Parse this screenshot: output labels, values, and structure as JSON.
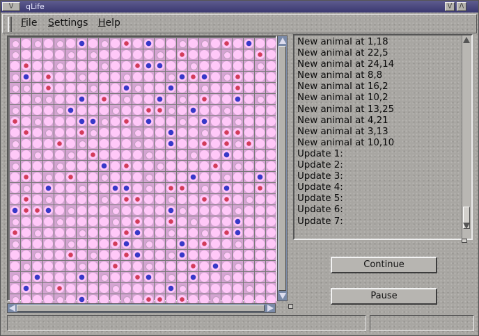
{
  "window": {
    "title": "qLife",
    "menu_button_label": "\\/",
    "minimize_label": "\\/",
    "maximize_label": "/\\"
  },
  "menubar": {
    "items": [
      {
        "label": "File",
        "mnemonic": "F",
        "rest": "ile"
      },
      {
        "label": "Settings",
        "mnemonic": "S",
        "rest": "ettings"
      },
      {
        "label": "Help",
        "mnemonic": "H",
        "rest": "elp"
      }
    ]
  },
  "grid": {
    "rows": 24,
    "cols": 24,
    "colors": {
      "cell_bg": "#d4a4d2",
      "dot": "#ffc8f8",
      "red": "#d23c5a",
      "blue": "#3838c8"
    },
    "red_cells": [
      [
        0,
        10
      ],
      [
        0,
        19
      ],
      [
        1,
        15
      ],
      [
        1,
        22
      ],
      [
        2,
        1
      ],
      [
        2,
        11
      ],
      [
        3,
        3
      ],
      [
        3,
        16
      ],
      [
        3,
        20
      ],
      [
        4,
        3
      ],
      [
        4,
        20
      ],
      [
        5,
        8
      ],
      [
        5,
        17
      ],
      [
        6,
        12
      ],
      [
        6,
        13
      ],
      [
        7,
        0
      ],
      [
        7,
        10
      ],
      [
        8,
        1
      ],
      [
        8,
        6
      ],
      [
        8,
        19
      ],
      [
        8,
        20
      ],
      [
        9,
        4
      ],
      [
        9,
        17
      ],
      [
        9,
        19
      ],
      [
        9,
        21
      ],
      [
        10,
        7
      ],
      [
        11,
        10
      ],
      [
        11,
        18
      ],
      [
        12,
        1
      ],
      [
        12,
        5
      ],
      [
        13,
        14
      ],
      [
        13,
        15
      ],
      [
        13,
        22
      ],
      [
        14,
        1
      ],
      [
        14,
        10
      ],
      [
        14,
        11
      ],
      [
        14,
        17
      ],
      [
        14,
        19
      ],
      [
        15,
        1
      ],
      [
        15,
        2
      ],
      [
        16,
        11
      ],
      [
        16,
        14
      ],
      [
        17,
        0
      ],
      [
        17,
        10
      ],
      [
        17,
        19
      ],
      [
        18,
        9
      ],
      [
        18,
        17
      ],
      [
        19,
        5
      ],
      [
        19,
        10
      ],
      [
        20,
        9
      ],
      [
        20,
        16
      ],
      [
        21,
        11
      ],
      [
        22,
        4
      ],
      [
        23,
        12
      ],
      [
        23,
        13
      ],
      [
        23,
        15
      ]
    ],
    "blue_cells": [
      [
        0,
        6
      ],
      [
        0,
        12
      ],
      [
        0,
        21
      ],
      [
        2,
        12
      ],
      [
        2,
        13
      ],
      [
        3,
        1
      ],
      [
        3,
        15
      ],
      [
        3,
        17
      ],
      [
        4,
        10
      ],
      [
        4,
        14
      ],
      [
        5,
        6
      ],
      [
        5,
        13
      ],
      [
        5,
        20
      ],
      [
        6,
        5
      ],
      [
        6,
        13
      ],
      [
        6,
        16
      ],
      [
        7,
        6
      ],
      [
        7,
        7
      ],
      [
        7,
        10
      ],
      [
        7,
        12
      ],
      [
        7,
        17
      ],
      [
        8,
        14
      ],
      [
        9,
        14
      ],
      [
        10,
        19
      ],
      [
        11,
        8
      ],
      [
        12,
        16
      ],
      [
        12,
        22
      ],
      [
        13,
        3
      ],
      [
        13,
        9
      ],
      [
        13,
        10
      ],
      [
        13,
        19
      ],
      [
        14,
        10
      ],
      [
        15,
        0
      ],
      [
        15,
        2
      ],
      [
        15,
        3
      ],
      [
        15,
        14
      ],
      [
        16,
        20
      ],
      [
        17,
        11
      ],
      [
        17,
        20
      ],
      [
        18,
        10
      ],
      [
        18,
        15
      ],
      [
        19,
        11
      ],
      [
        19,
        15
      ],
      [
        20,
        18
      ],
      [
        21,
        2
      ],
      [
        21,
        6
      ],
      [
        21,
        12
      ],
      [
        21,
        16
      ],
      [
        22,
        1
      ],
      [
        22,
        14
      ],
      [
        23,
        6
      ]
    ],
    "small_cells": [
      [
        0,
        0
      ],
      [
        0,
        2
      ],
      [
        0,
        4
      ],
      [
        0,
        8
      ],
      [
        0,
        15
      ],
      [
        0,
        17
      ],
      [
        1,
        0
      ],
      [
        1,
        5
      ],
      [
        1,
        7
      ],
      [
        1,
        13
      ],
      [
        1,
        19
      ],
      [
        2,
        4
      ],
      [
        2,
        8
      ],
      [
        2,
        16
      ],
      [
        2,
        22
      ],
      [
        3,
        0
      ],
      [
        3,
        6
      ],
      [
        3,
        10
      ],
      [
        3,
        14
      ],
      [
        3,
        19
      ],
      [
        4,
        0
      ],
      [
        4,
        1
      ],
      [
        4,
        7
      ],
      [
        4,
        11
      ],
      [
        4,
        17
      ],
      [
        5,
        2
      ],
      [
        5,
        3
      ],
      [
        5,
        10
      ],
      [
        5,
        15
      ],
      [
        5,
        22
      ],
      [
        6,
        0
      ],
      [
        6,
        4
      ],
      [
        6,
        9
      ],
      [
        6,
        14
      ],
      [
        6,
        19
      ],
      [
        7,
        2
      ],
      [
        7,
        8
      ],
      [
        7,
        15
      ],
      [
        7,
        20
      ],
      [
        8,
        3
      ],
      [
        8,
        7
      ],
      [
        8,
        11
      ],
      [
        8,
        17
      ],
      [
        9,
        0
      ],
      [
        9,
        6
      ],
      [
        9,
        11
      ],
      [
        9,
        20
      ],
      [
        10,
        2
      ],
      [
        10,
        5
      ],
      [
        10,
        12
      ],
      [
        10,
        16
      ],
      [
        11,
        0
      ],
      [
        11,
        4
      ],
      [
        11,
        13
      ],
      [
        11,
        20
      ],
      [
        12,
        3
      ],
      [
        12,
        8
      ],
      [
        12,
        12
      ],
      [
        12,
        19
      ],
      [
        13,
        1
      ],
      [
        13,
        6
      ],
      [
        13,
        12
      ],
      [
        13,
        17
      ],
      [
        14,
        3
      ],
      [
        14,
        8
      ],
      [
        14,
        14
      ],
      [
        14,
        21
      ],
      [
        15,
        5
      ],
      [
        15,
        9
      ],
      [
        15,
        15
      ],
      [
        15,
        20
      ],
      [
        16,
        0
      ],
      [
        16,
        4
      ],
      [
        16,
        9
      ],
      [
        16,
        16
      ],
      [
        17,
        2
      ],
      [
        17,
        6
      ],
      [
        17,
        14
      ],
      [
        17,
        17
      ],
      [
        18,
        0
      ],
      [
        18,
        5
      ],
      [
        18,
        12
      ],
      [
        18,
        20
      ],
      [
        19,
        2
      ],
      [
        19,
        7
      ],
      [
        19,
        14
      ],
      [
        19,
        19
      ],
      [
        20,
        1
      ],
      [
        20,
        6
      ],
      [
        20,
        12
      ],
      [
        20,
        20
      ],
      [
        21,
        0
      ],
      [
        21,
        8
      ],
      [
        21,
        14
      ],
      [
        21,
        19
      ],
      [
        22,
        3
      ],
      [
        22,
        9
      ],
      [
        22,
        15
      ],
      [
        22,
        21
      ],
      [
        23,
        0
      ],
      [
        23,
        4
      ],
      [
        23,
        10
      ],
      [
        23,
        18
      ]
    ]
  },
  "log": {
    "lines": [
      "New animal at 1,18",
      "New animal at 22,5",
      "New animal at 24,14",
      "New animal at 8,8",
      "New animal at 16,2",
      "New animal at 10,2",
      "New animal at 13,25",
      "New animal at 4,21",
      "New animal at 3,13",
      "New animal at 10,10",
      "Update 1:",
      "Update 2:",
      "Update 3:",
      "Update 4:",
      "Update 5:",
      "Update 6:",
      "Update 7:"
    ]
  },
  "buttons": {
    "continue_label": "Continue",
    "pause_label": "Pause"
  },
  "status": {
    "left": "",
    "right": ""
  }
}
